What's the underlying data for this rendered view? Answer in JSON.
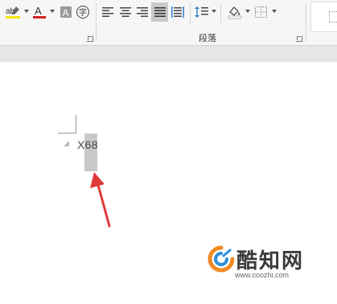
{
  "ribbon": {
    "paragraph_group_label": "段落",
    "tools_left": [
      {
        "icon": "text-highlight-color-icon",
        "label": "ab",
        "color": "#f2e600"
      },
      {
        "icon": "font-color-icon",
        "label": "A",
        "color": "#d42020"
      },
      {
        "icon": "character-shading-icon",
        "label": "A"
      },
      {
        "icon": "enclose-characters-icon",
        "label": "字"
      }
    ],
    "alignment": [
      "align-left-icon",
      "align-center-icon",
      "align-right-icon",
      "justify-icon",
      "distributed-icon"
    ],
    "other": [
      "line-spacing-icon",
      "shading-icon",
      "borders-icon"
    ]
  },
  "document": {
    "text": "X68",
    "selection_color": "#c8c8c8"
  },
  "annotation": {
    "arrow_color": "#e03a3a"
  },
  "watermark": {
    "title": "酷知网",
    "url": "www.coozhi.com",
    "logo_colors": [
      "#f08a24",
      "#2f8fd8"
    ]
  }
}
